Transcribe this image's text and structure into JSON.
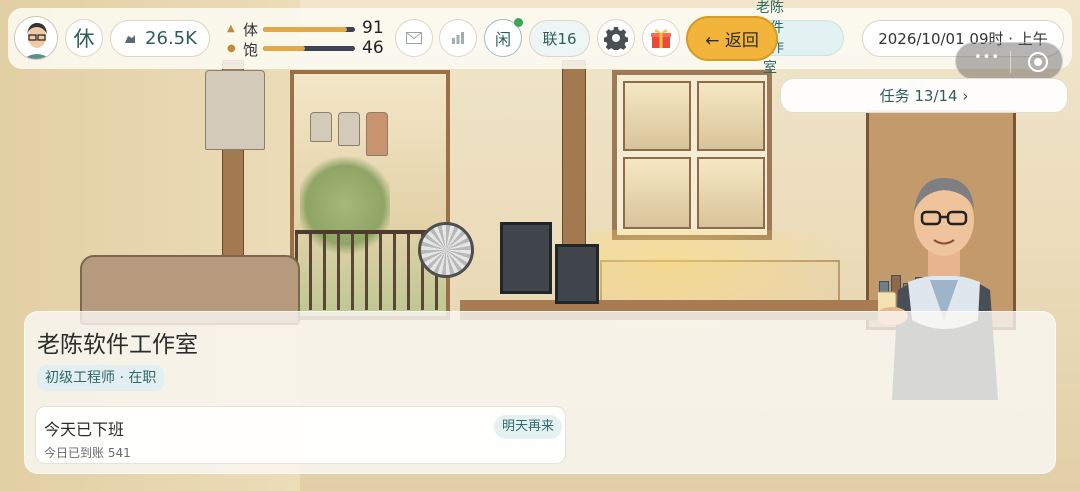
{
  "header": {
    "rest_label": "休",
    "coins": "26.5K",
    "stats": [
      {
        "label": "体",
        "value": "91",
        "level": 0.91,
        "color": "#e3a848"
      },
      {
        "label": "饱",
        "value": "46",
        "level": 0.46,
        "color": "#e3a848"
      }
    ],
    "idle_label": "闲",
    "contacts_label": "联16",
    "back_label": "← 返回",
    "studio_vertical": "老陈软件工作室",
    "datetime": "2026/10/01 09时 · 上午",
    "miniprogram_more": "•••",
    "tasks_label": "任务 13/14 ›"
  },
  "studio": {
    "name": "老陈软件工作室",
    "role": "初级工程师 · 在职",
    "status_title": "今天已下班",
    "status_action": "明天再来",
    "income_text": "今日已到账 541"
  },
  "colors": {
    "accent": "#2f5e58",
    "back_button": "#f2b43b",
    "bar_track": "#3c4553",
    "online_dot": "#3aa657"
  },
  "icons": [
    "avatar",
    "coin-icon",
    "stamina-icon",
    "food-icon",
    "mail-icon",
    "stats-icon",
    "gear-icon",
    "gift-icon",
    "more-icon",
    "record-icon"
  ]
}
